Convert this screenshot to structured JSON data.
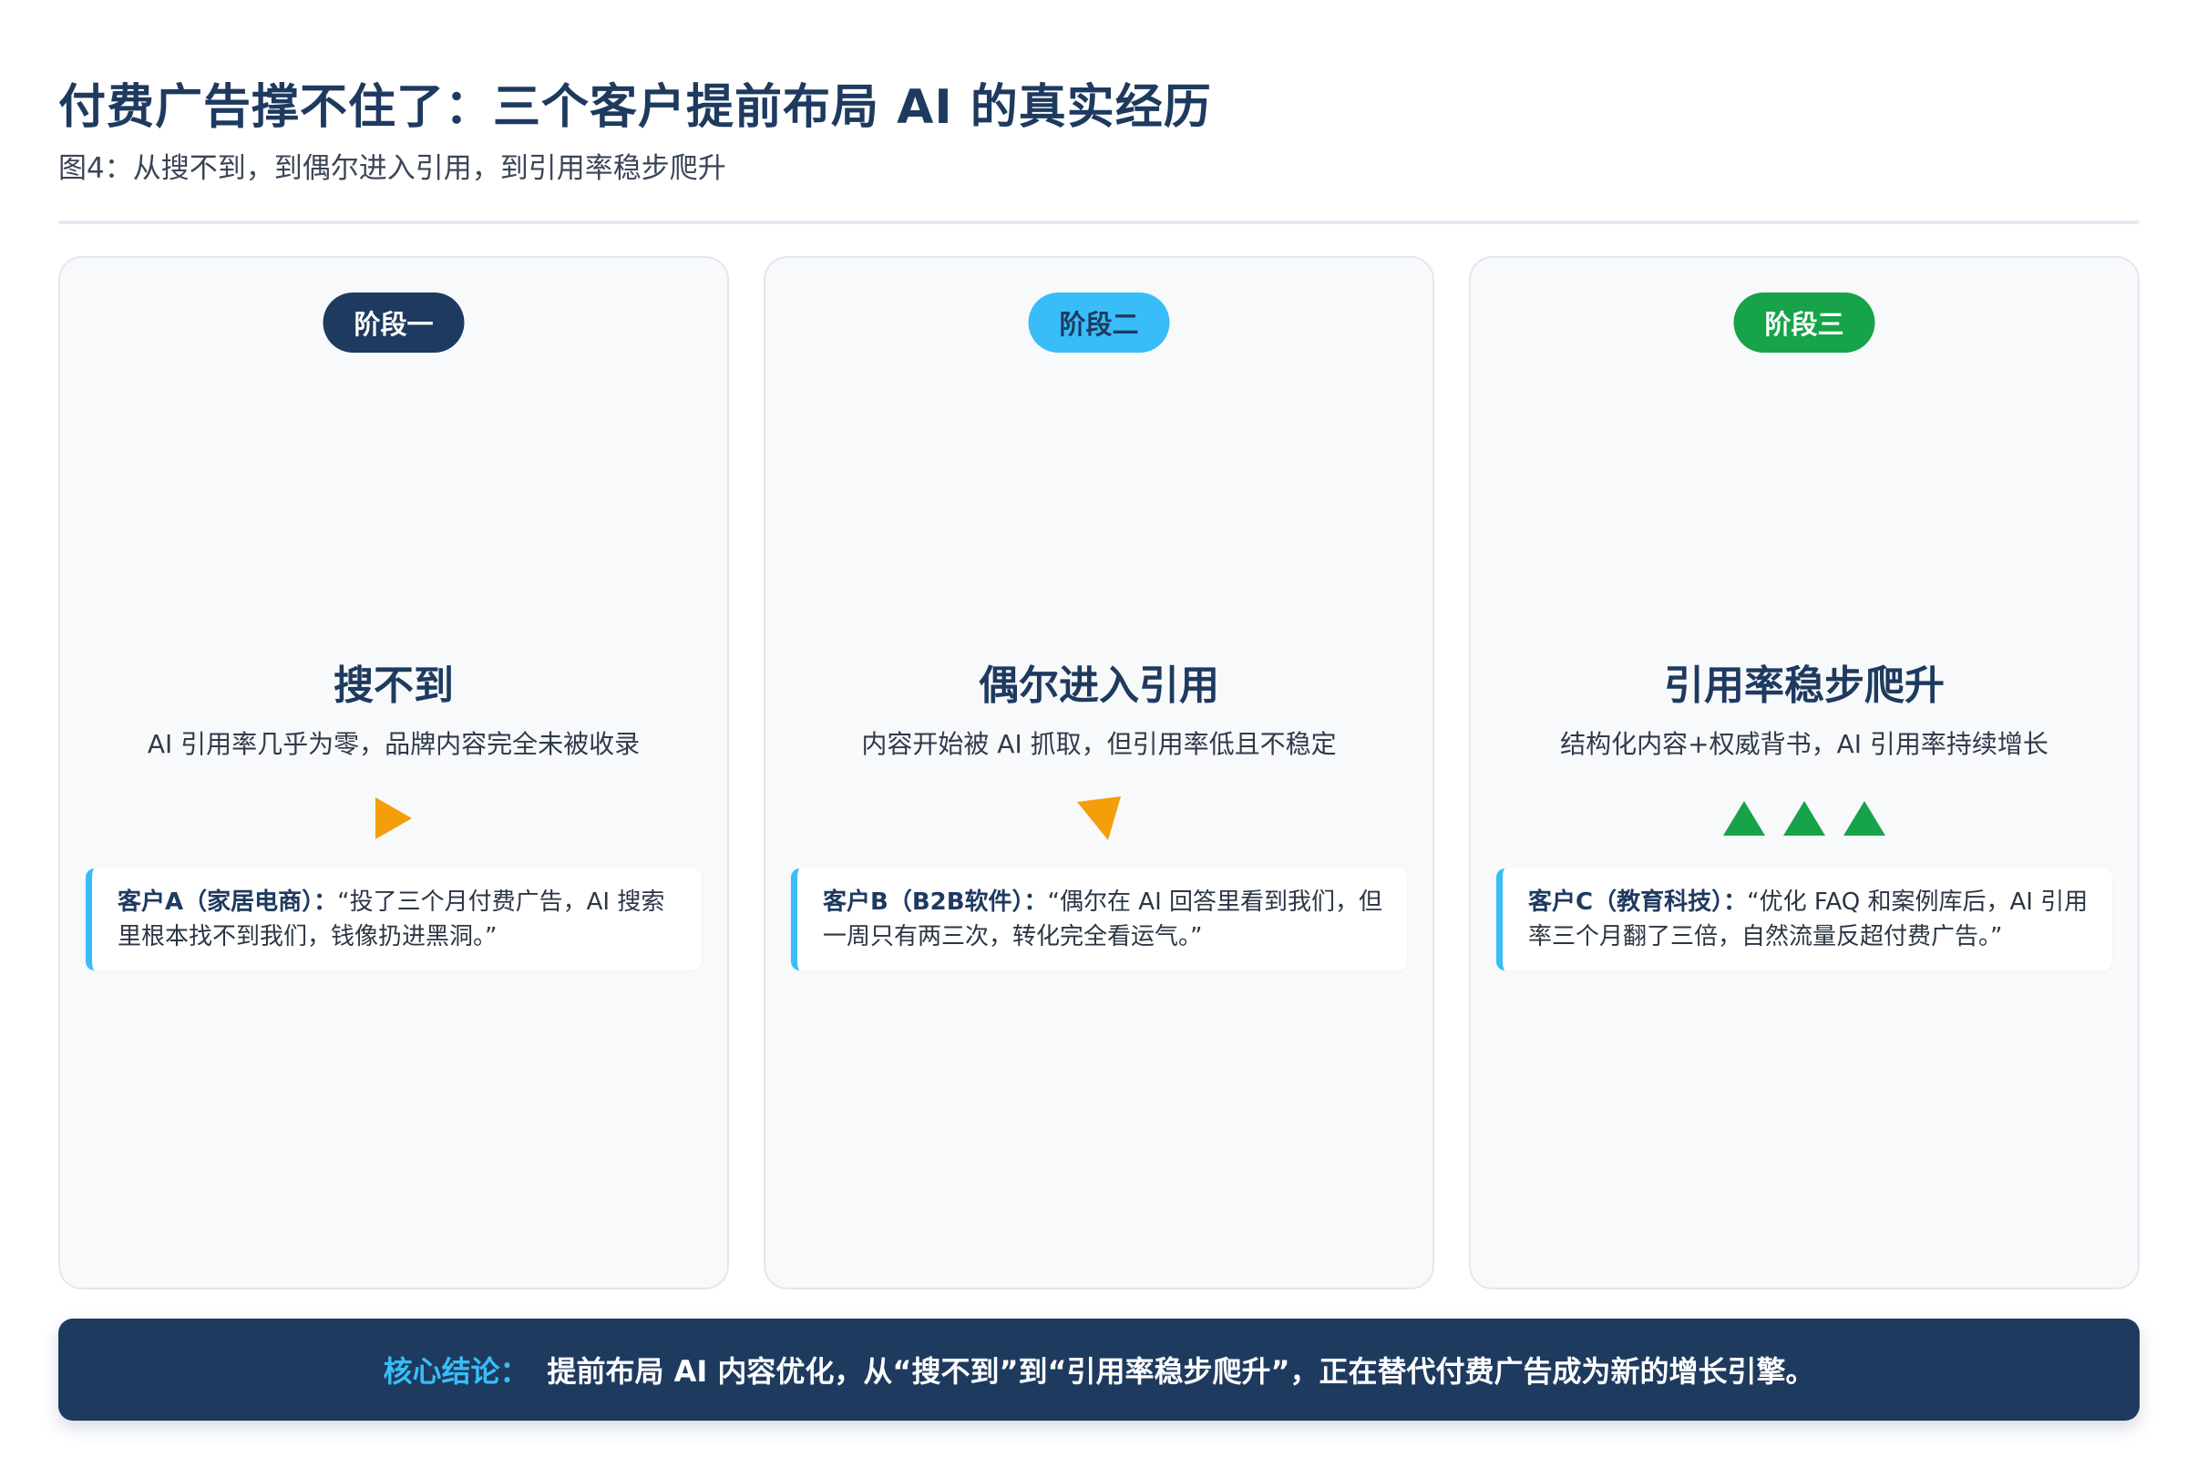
{
  "header": {
    "title": "付费广告撑不住了：三个客户提前布局 AI 的真实经历",
    "subtitle": "图4：从搜不到，到偶尔进入引用，到引用率稳步爬升"
  },
  "colors": {
    "primary": "#1e3a5f",
    "accent": "#38bdf8",
    "stage1": "#1e3a5f",
    "stage2": "#38bdf8",
    "stage3": "#16a34a",
    "warning": "#f59e0b",
    "growth": "#16a34a"
  },
  "stages": [
    {
      "badge": "阶段一",
      "title": "搜不到",
      "desc": "AI 引用率几乎为零，品牌内容完全未被收录",
      "indicator_icon": "play-arrow-icon",
      "quote": {
        "client": "客户A（家居电商）：",
        "text": "“投了三个月付费广告，AI 搜索里根本找不到我们，钱像扔进黑洞。”"
      }
    },
    {
      "badge": "阶段二",
      "title": "偶尔进入引用",
      "desc": "内容开始被 AI 抓取，但引用率低且不稳定",
      "indicator_icon": "tilted-arrow-icon",
      "quote": {
        "client": "客户B（B2B软件）：",
        "text": "“偶尔在 AI 回答里看到我们，但一周只有两三次，转化完全看运气。”"
      }
    },
    {
      "badge": "阶段三",
      "title": "引用率稳步爬升",
      "desc": "结构化内容+权威背书，AI 引用率持续增长",
      "indicator_icon": "triangle-up-icon",
      "quote": {
        "client": "客户C（教育科技）：",
        "text": "“优化 FAQ 和案例库后，AI 引用率三个月翻了三倍，自然流量反超付费广告。”"
      }
    }
  ],
  "conclusion": {
    "label": "核心结论：",
    "text": "提前布局 AI 内容优化，从“搜不到”到“引用率稳步爬升”，正在替代付费广告成为新的增长引擎。"
  }
}
